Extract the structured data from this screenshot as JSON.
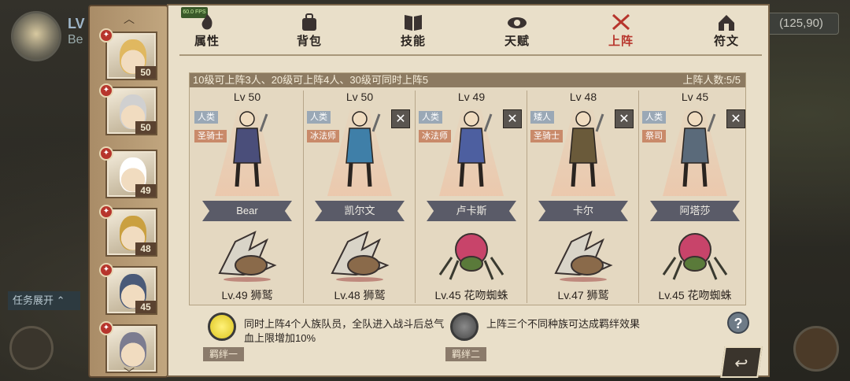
{
  "scene": {
    "level_label": "LV",
    "name_partial": "Be",
    "task_label": "任务展开",
    "coords": "(125,90)"
  },
  "fps": "60.0 FPS",
  "tabs": [
    {
      "label": "属性",
      "icon": "fire-icon",
      "active": false
    },
    {
      "label": "背包",
      "icon": "bag-icon",
      "active": false
    },
    {
      "label": "技能",
      "icon": "book-icon",
      "active": false
    },
    {
      "label": "天赋",
      "icon": "eye-icon",
      "active": false
    },
    {
      "label": "上阵",
      "icon": "crossed-swords-icon",
      "active": true
    },
    {
      "label": "符文",
      "icon": "house-rune-icon",
      "active": false
    }
  ],
  "hero_list": [
    {
      "level": "50",
      "hair": "#e0b860"
    },
    {
      "level": "50",
      "hair": "#d0d0d0"
    },
    {
      "level": "49",
      "hair": "#ffffff"
    },
    {
      "level": "48",
      "hair": "#caa040"
    },
    {
      "level": "45",
      "hair": "#4a5a78"
    },
    {
      "level": "",
      "hair": "#7c7c90"
    }
  ],
  "team": {
    "rule_text": "10级可上阵3人、20级可上阵4人、30级可同时上阵5",
    "count_text": "上阵人数:5/5",
    "slots": [
      {
        "level": "Lv 50",
        "race": "人类",
        "class": "圣骑士",
        "name": "Bear",
        "removable": false,
        "pet": "Lv.49 狮鹫",
        "pet_type": "griffin",
        "color": "#4a4e7a"
      },
      {
        "level": "Lv 50",
        "race": "人类",
        "class": "冰法师",
        "name": "凯尔文",
        "removable": true,
        "pet": "Lv.48 狮鹫",
        "pet_type": "griffin",
        "color": "#3f7fa8"
      },
      {
        "level": "Lv 49",
        "race": "人类",
        "class": "冰法师",
        "name": "卢卡斯",
        "removable": true,
        "pet": "Lv.45 花吻蜘蛛",
        "pet_type": "spider",
        "color": "#4d5fa0"
      },
      {
        "level": "Lv 48",
        "race": "矮人",
        "class": "圣骑士",
        "name": "卡尔",
        "removable": true,
        "pet": "Lv.47 狮鹫",
        "pet_type": "griffin",
        "color": "#6a5a3a"
      },
      {
        "level": "Lv 45",
        "race": "人类",
        "class": "祭司",
        "name": "阿塔莎",
        "removable": true,
        "pet": "Lv.45 花吻蜘蛛",
        "pet_type": "spider",
        "color": "#5a6a7a"
      }
    ],
    "remove_symbol": "✕"
  },
  "bonds": [
    {
      "name": "羁绊一",
      "desc": "同时上阵4个人族队员，全队进入战斗后总气血上限增加10%",
      "active": true
    },
    {
      "name": "羁绊二",
      "desc": "上阵三个不同种族可达成羁绊效果",
      "active": false
    }
  ],
  "help_symbol": "?",
  "back_symbol": "↩"
}
